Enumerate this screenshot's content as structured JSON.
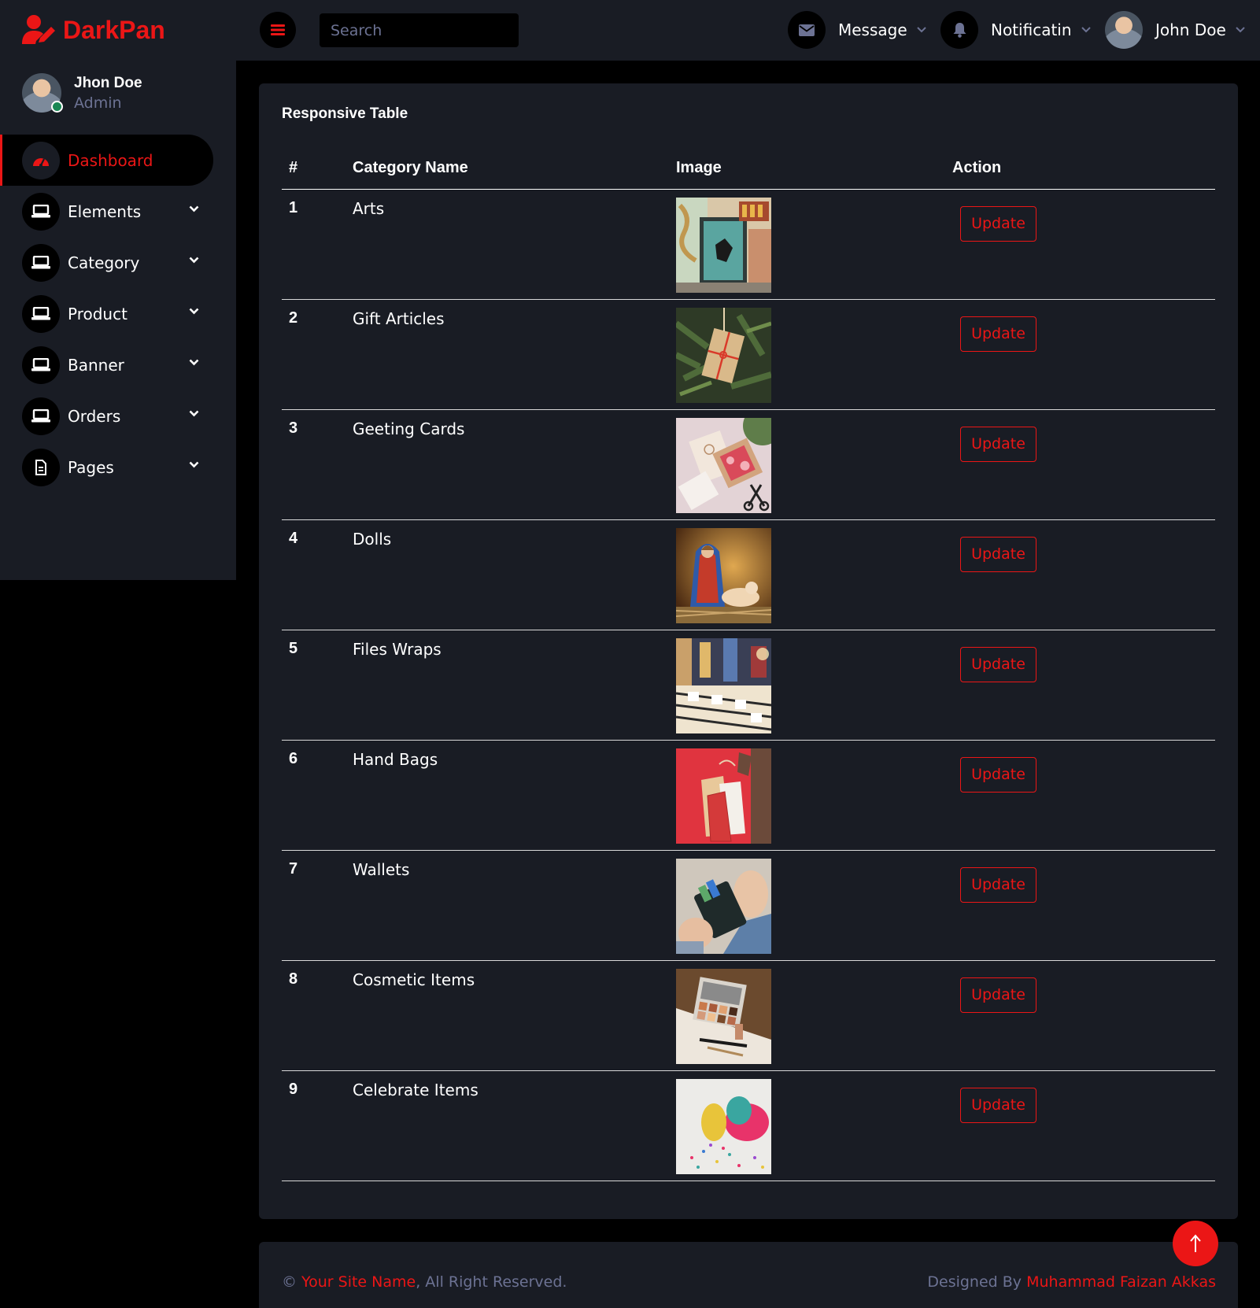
{
  "brand": {
    "name": "DarkPan",
    "accent_color": "#eb1616"
  },
  "topbar": {
    "search_placeholder": "Search",
    "message_label": "Message",
    "notification_label": "Notificatin",
    "user_name": "John Doe"
  },
  "sidebar": {
    "profile_name": "Jhon Doe",
    "profile_role": "Admin",
    "items": [
      {
        "label": "Dashboard",
        "icon": "tachometer-icon",
        "active": true
      },
      {
        "label": "Elements",
        "icon": "laptop-icon"
      },
      {
        "label": "Category",
        "icon": "laptop-icon"
      },
      {
        "label": "Product",
        "icon": "laptop-icon"
      },
      {
        "label": "Banner",
        "icon": "laptop-icon"
      },
      {
        "label": "Orders",
        "icon": "laptop-icon"
      },
      {
        "label": "Pages",
        "icon": "file-icon"
      }
    ]
  },
  "table": {
    "title": "Responsive Table",
    "headers": [
      "#",
      "Category Name",
      "Image",
      "Action"
    ],
    "action_label": "Update",
    "rows": [
      {
        "num": "1",
        "name": "Arts",
        "image": "street-mural-photo"
      },
      {
        "num": "2",
        "name": "Gift Articles",
        "image": "gift-on-tree-photo"
      },
      {
        "num": "3",
        "name": "Geeting Cards",
        "image": "greeting-cards-photo"
      },
      {
        "num": "4",
        "name": "Dolls",
        "image": "nativity-figurines-photo"
      },
      {
        "num": "5",
        "name": "Files Wraps",
        "image": "record-shop-photo"
      },
      {
        "num": "6",
        "name": "Hand Bags",
        "image": "shopping-bags-photo"
      },
      {
        "num": "7",
        "name": "Wallets",
        "image": "wallet-in-hands-photo"
      },
      {
        "num": "8",
        "name": "Cosmetic Items",
        "image": "makeup-palette-photo"
      },
      {
        "num": "9",
        "name": "Celebrate Items",
        "image": "balloons-confetti-photo"
      }
    ]
  },
  "footer": {
    "copyright_symbol": "©",
    "site_name": "Your Site Name",
    "rights": ", All Right Reserved.",
    "designed_by": "Designed By",
    "designer": "Muhammad Faizan Akkas"
  }
}
